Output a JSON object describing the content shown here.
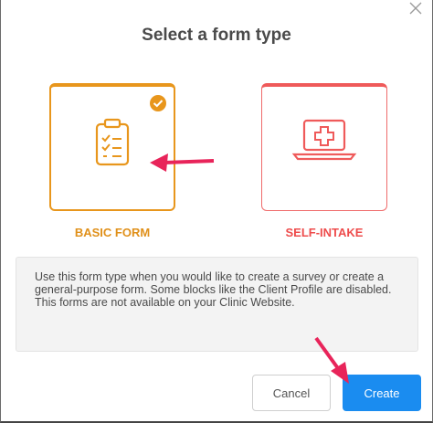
{
  "dialog": {
    "title": "Select a form type",
    "close_icon": "close-icon"
  },
  "options": [
    {
      "label": "BASIC FORM",
      "icon": "clipboard-checklist-icon",
      "selected": true,
      "color": "#e8961c"
    },
    {
      "label": "SELF-INTAKE",
      "icon": "laptop-medical-cross-icon",
      "selected": false,
      "color": "#ef5a5a"
    }
  ],
  "description": "Use this form type when you would like to create a survey or create a general-purpose form. Some blocks like the Client Profile are disabled. This forms are not available on your Clinic Website.",
  "buttons": {
    "cancel": "Cancel",
    "create": "Create"
  },
  "colors": {
    "accent_blue": "#1a8cf0",
    "annotation_arrow": "#e8245a"
  }
}
